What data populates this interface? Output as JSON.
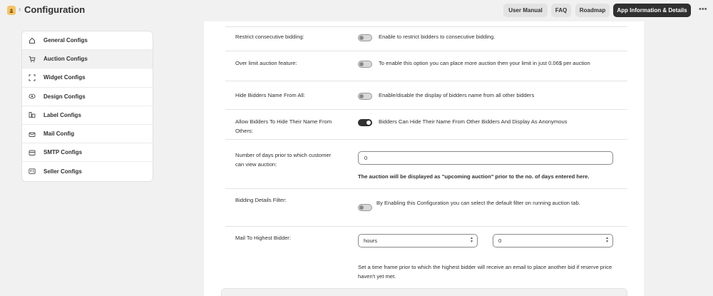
{
  "header": {
    "title": "Configuration",
    "app_icon": "store-icon",
    "breadcrumb_sep": "›",
    "buttons": {
      "user_manual": "User Manual",
      "faq": "FAQ",
      "roadmap": "Roadmap",
      "app_info": "App Information & Details"
    },
    "more_icon": "•••"
  },
  "sidebar": {
    "items": [
      {
        "label": "General Configs",
        "icon": "home-icon"
      },
      {
        "label": "Auction Configs",
        "icon": "cart-icon"
      },
      {
        "label": "Widget Configs",
        "icon": "frame-icon"
      },
      {
        "label": "Design Configs",
        "icon": "eye-icon"
      },
      {
        "label": "Label Configs",
        "icon": "label-icon"
      },
      {
        "label": "Mail Config",
        "icon": "mail-icon"
      },
      {
        "label": "SMTP Configs",
        "icon": "envelope-icon"
      },
      {
        "label": "Seller Configs",
        "icon": "id-card-icon"
      }
    ],
    "active_index": 1
  },
  "settings": {
    "restrict": {
      "label": "Restrict consecutive bidding:",
      "description": "Enable to restrict bidders to consecutive bidding.",
      "enabled": false
    },
    "over_limit": {
      "label": "Over limit auction feature:",
      "description": "To enable this option you can place more auction then your limit in just 0.06$ per auction",
      "enabled": false
    },
    "hide_names": {
      "label": "Hide Bidders Name From All:",
      "description": "Enable/disable the display of bidders name from all other bidders",
      "enabled": false
    },
    "allow_hide": {
      "label": "Allow Bidders To Hide Their Name From Others:",
      "description": "Bidders Can Hide Their Name From Other Bidders And Display As Anonymous",
      "enabled": true
    },
    "days_prior": {
      "label": "Number of days prior to which customer can view auction:",
      "value": "0",
      "help": "The auction will be displayed as \"upcoming auction\" prior to the no. of days entered here."
    },
    "bidding_filter": {
      "label": "Bidding Details Filter:",
      "description": "By Enabling this Configuration you can select the default filter on running auction tab.",
      "enabled": false
    },
    "mail_highest": {
      "label": "Mail To Highest Bidder:",
      "unit_value": "hours",
      "amount_value": "0",
      "help": "Set a time frame prior to which the highest bidder will receive an email to place another bid if reserve price haven't yet met."
    }
  }
}
